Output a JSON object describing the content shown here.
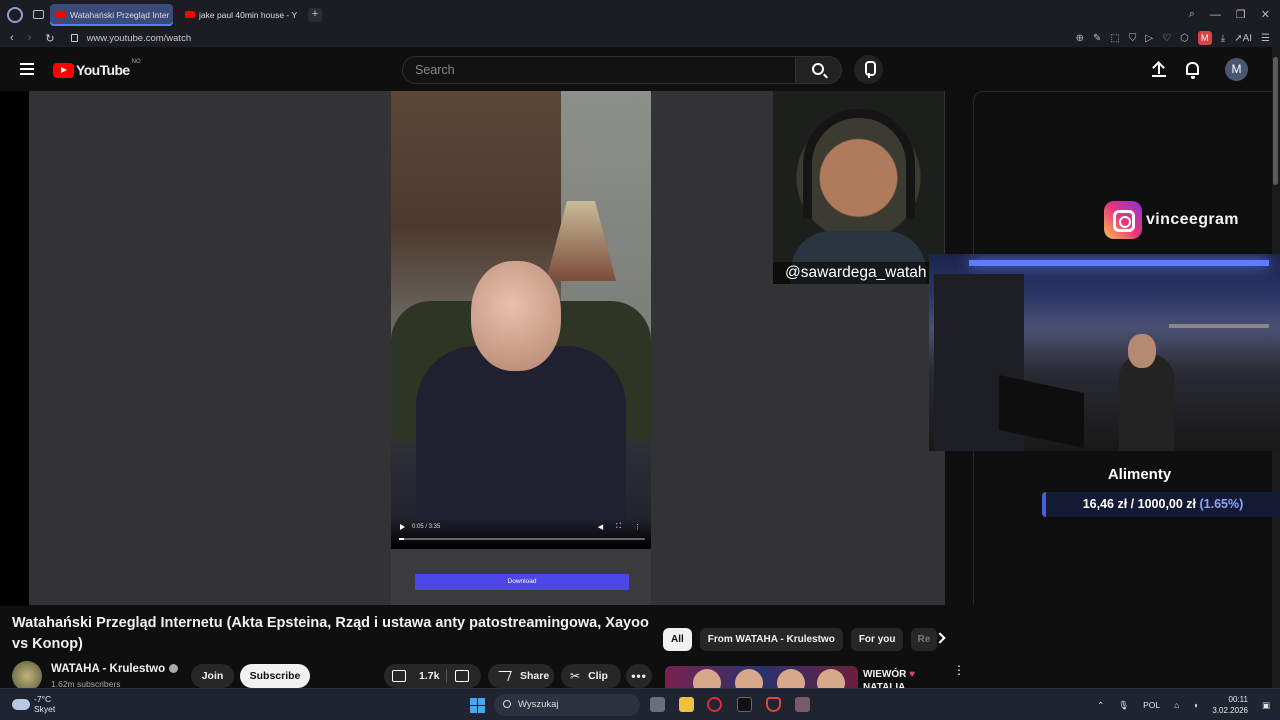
{
  "browser": {
    "tabs": [
      {
        "label": "Watahański Przegląd Inter",
        "active": true
      },
      {
        "label": "jake paul 40min house - Y",
        "active": false
      }
    ],
    "new_tab": "+",
    "url": "www.youtube.com/watch",
    "profile_badge": "M",
    "ai_label": "AI"
  },
  "youtube": {
    "logo_text": "YouTube",
    "country_code": "NO",
    "search_placeholder": "Search",
    "avatar_letter": "M"
  },
  "video": {
    "inner_time": "0:05 / 3:35",
    "inner_progress": 0.02,
    "download_label": "Download",
    "webcam_handle": "@sawardega_watah",
    "instagram_name": "vinceegram",
    "goal_title": "Alimenty",
    "goal_current": "16,46 zł",
    "goal_separator": "/",
    "goal_target": "1000,00 zł",
    "goal_percent": "(1.65%)"
  },
  "watch": {
    "title": "Watahański Przegląd Internetu (Akta Epsteina, Rząd i ustawa anty patostreamingowa, Xayoo vs Konop)",
    "channel": "WATAHA - Krulestwo",
    "subscribers": "1.62m subscribers",
    "join_label": "Join",
    "subscribe_label": "Subscribe",
    "likes": "1.7k",
    "share_label": "Share",
    "clip_label": "Clip",
    "more_label": "•••"
  },
  "recommendations": {
    "chips": [
      "All",
      "From WATAHA - Krulestwo",
      "For you",
      "Re"
    ],
    "first_title_line1": "WIEWÓR",
    "first_title_line2": "NATALIA"
  },
  "taskbar": {
    "temperature": "-7°C",
    "weather_desc": "Skyet",
    "search_label": "Wyszukaj",
    "language": "POL",
    "time": "00:11",
    "date": "3.02.2026"
  }
}
